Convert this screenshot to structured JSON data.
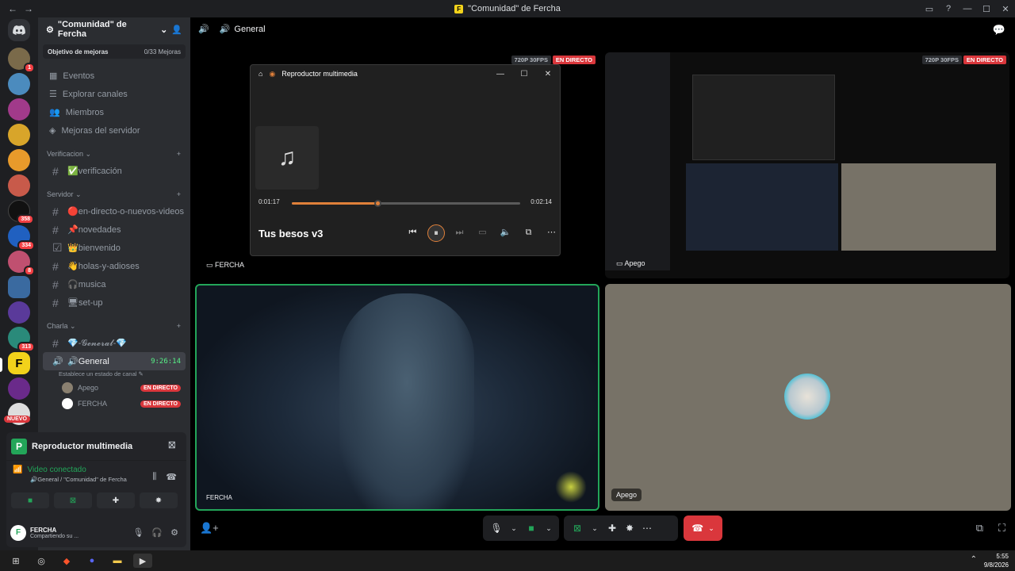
{
  "window": {
    "title": "\"Comunidad\" de Fercha",
    "logo_letter": "F",
    "nav_back": "←",
    "nav_forward": "→",
    "controls": [
      "▭",
      "?",
      "—",
      "☐",
      "✕"
    ]
  },
  "guilds": {
    "home_icon": "discord-logo",
    "badges": [
      "1",
      "358",
      "334",
      "8",
      "313"
    ],
    "new_label": "NUEVO"
  },
  "sidebar": {
    "server_name": "\"Comunidad\" de Fercha",
    "goal_label": "Objetivo de mejoras",
    "goal_count": "0/33 Mejoras",
    "menu": [
      "Eventos",
      "Explorar canales",
      "Miembros",
      "Mejoras del servidor"
    ],
    "categories": {
      "verificacion": "Verificacion",
      "servidor": "Servidor",
      "charla": "Charla"
    },
    "verificacion_channels": [
      "✅verificación"
    ],
    "servidor_channels": [
      "🔴en-directo-o-nuevos-videos",
      "📌novedades",
      "👑bienvenido",
      "👋holas-y-adioses",
      "🎧musica",
      "🖥set-up"
    ],
    "charla_channels": [
      "💎-𝓖𝓮𝓷𝓮𝓻𝓪𝓵-💎"
    ],
    "voice_channel": "🔊General",
    "voice_time": "9:26:14",
    "voice_status": "Establece un estado de canal",
    "voice_users": [
      {
        "name": "Apego",
        "live": "EN DIRECTO"
      },
      {
        "name": "FERCHA",
        "live": "EN DIRECTO"
      }
    ]
  },
  "panel": {
    "now_playing": "Reproductor multimedia",
    "connection_title": "Video conectado",
    "connection_sub": "🔊General / \"Comunidad\" de Fercha",
    "user_name": "FERCHA",
    "user_status": "Compartiendo su ..."
  },
  "main": {
    "channel_title": "General",
    "stream_quality": "720P 30FPS",
    "live_label": "EN DIRECTO",
    "stream_label_1": "FERCHA",
    "stream_label_2": "Apego",
    "tile_label_fercha": "FERCHA",
    "tile_label_apego": "Apego"
  },
  "media_player": {
    "app_title": "Reproductor multimedia",
    "elapsed": "0:01:17",
    "total": "0:02:14",
    "progress": 0.375,
    "song": "Tus besos v3"
  },
  "taskbar": {
    "time": "5:55",
    "date": "9/8/2026"
  },
  "colors": {
    "accent_live": "#da373c",
    "connected_green": "#23a559",
    "progress_orange": "#e0803a"
  }
}
